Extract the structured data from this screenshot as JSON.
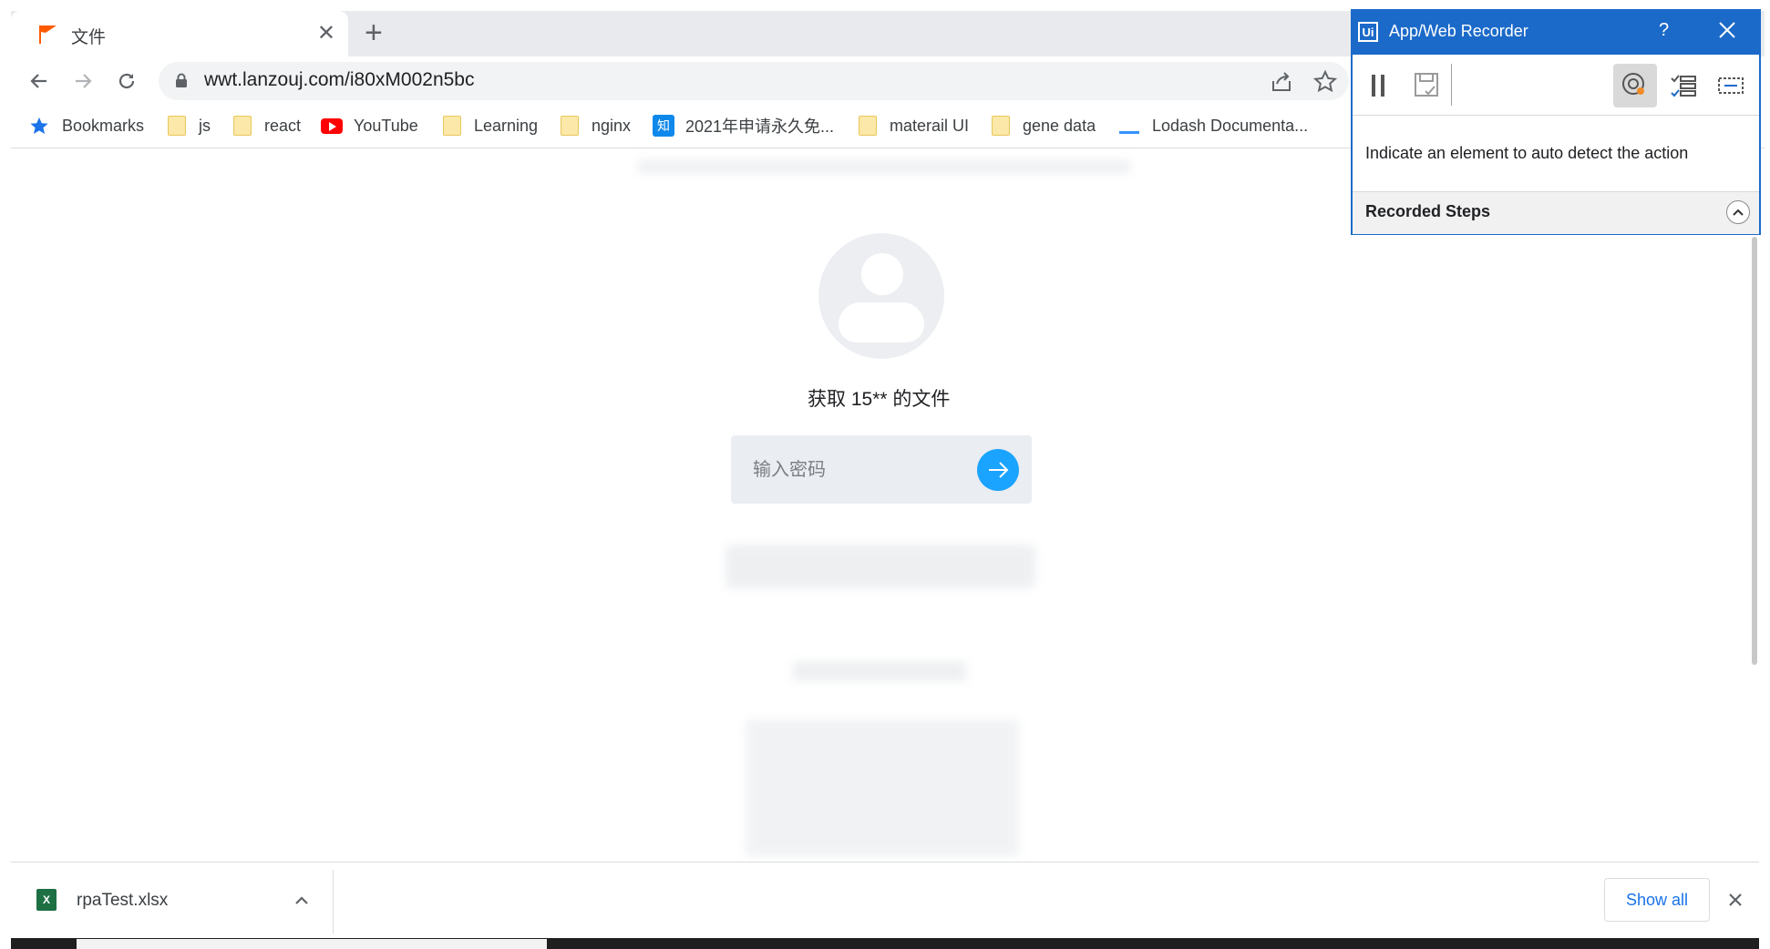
{
  "browser": {
    "tab": {
      "title": "文件",
      "favicon": "lanzou-flag-icon"
    },
    "address_bar": {
      "url": "wwt.lanzouj.com/i80xM002n5bc"
    },
    "bookmarks": [
      {
        "label": "Bookmarks",
        "icon": "star-icon"
      },
      {
        "label": "js",
        "icon": "folder-icon"
      },
      {
        "label": "react",
        "icon": "folder-icon"
      },
      {
        "label": "YouTube",
        "icon": "youtube-icon"
      },
      {
        "label": "Learning",
        "icon": "folder-icon"
      },
      {
        "label": "nginx",
        "icon": "folder-icon"
      },
      {
        "label": "2021年申请永久免...",
        "icon": "zhihu-icon",
        "icon_text": "知"
      },
      {
        "label": "materail UI",
        "icon": "folder-icon"
      },
      {
        "label": "gene data",
        "icon": "folder-icon"
      },
      {
        "label": "Lodash Documenta...",
        "icon": "lodash-icon"
      }
    ]
  },
  "page": {
    "heading": "获取 15** 的文件",
    "password_input": {
      "placeholder": "输入密码",
      "value": ""
    }
  },
  "recorder": {
    "logo": "Ui",
    "title": "App/Web Recorder",
    "help_label": "?",
    "hint": "Indicate an element to auto detect the action",
    "recorded_steps_label": "Recorded Steps",
    "accent_color": "#1b6ac9"
  },
  "downloads": {
    "items": [
      {
        "name": "rpaTest.xlsx",
        "icon_text": "X"
      }
    ],
    "show_all_label": "Show all"
  }
}
